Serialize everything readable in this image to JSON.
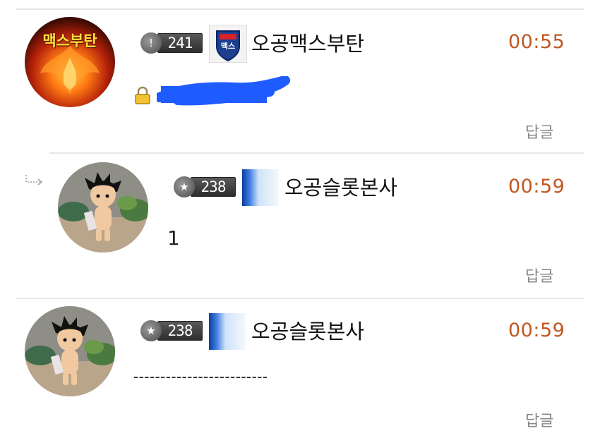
{
  "comments": [
    {
      "level": "241",
      "level_icon": "exclamation",
      "nickname": "오공맥스부탄",
      "time": "00:55",
      "body": "",
      "body_icon": "lock-icon",
      "reply_label": "답글",
      "avatar_text": "맥스부탄",
      "grade_icon_text": "맥스"
    },
    {
      "level": "238",
      "level_icon": "star",
      "nickname": "오공슬롯본사",
      "time": "00:59",
      "body": "1",
      "reply_label": "답글"
    },
    {
      "level": "238",
      "level_icon": "star",
      "nickname": "오공슬롯본사",
      "time": "00:59",
      "body": "-------------------------",
      "reply_label": "답글"
    }
  ],
  "colors": {
    "time": "#c1561f",
    "reply": "#888888",
    "divider": "#e6e6e6",
    "redaction": "#1f5cff"
  }
}
